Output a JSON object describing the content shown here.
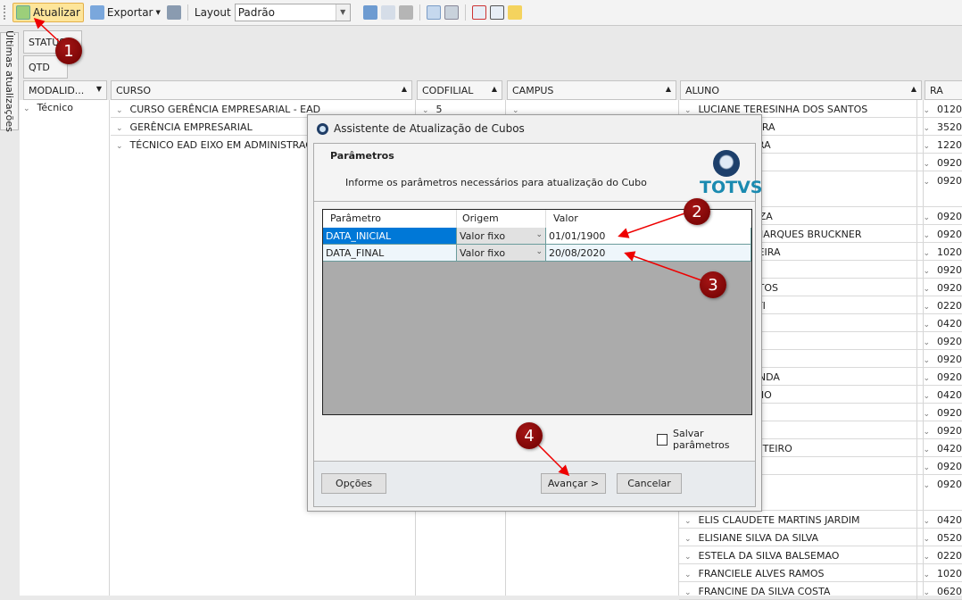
{
  "toolbar": {
    "refresh_label": "Atualizar",
    "export_label": "Exportar",
    "layout_label": "Layout",
    "layout_value": "Padrão"
  },
  "side_tab": {
    "label": "Últimas atualizações"
  },
  "fields": {
    "status": "STATUS",
    "qtd": "QTD"
  },
  "columns": {
    "modalidade": "MODALID...",
    "curso": "CURSO",
    "codfilial": "CODFILIAL",
    "campus": "CAMPUS",
    "aluno": "ALUNO",
    "ra": "RA"
  },
  "groups": {
    "modalidade": "Técnico",
    "cursos": [
      "CURSO GERÊNCIA EMPRESARIAL - EAD",
      "GERÊNCIA EMPRESARIAL",
      "TÉCNICO  EAD EIXO EM ADMINISTRAÇÃO"
    ],
    "codfilial": "5",
    "campus": ""
  },
  "alunos": [
    {
      "name": "LUCIANE TERESINHA DOS SANTOS",
      "ra": "0120"
    },
    {
      "name": "OS DA SILVEIRA",
      "ra": "3520"
    },
    {
      "name": "IA DA SILVEIRA",
      "ra": "1220"
    },
    {
      "name": "UZA",
      "ra": "0920"
    },
    {
      "name": "DA SILVA",
      "ra": "0920",
      "tall": true
    },
    {
      "name": "ARA DE SOUZA",
      "ra": "0920"
    },
    {
      "name": "A MENZEM MARQUES BRUCKNER",
      "ra": "0920"
    },
    {
      "name": "ZAUZA OLIVEIRA",
      "ra": "1020"
    },
    {
      "name": "O VIEIRA",
      "ra": "0920"
    },
    {
      "name": "EL DOS SANTOS",
      "ra": "0920"
    },
    {
      "name": "UDO PEDRETI",
      "ra": "0220"
    },
    {
      "name": "DA SILVA",
      "ra": "0420"
    },
    {
      "name": "Z VIEIRA",
      "ra": "0920"
    },
    {
      "name": "VIERO",
      "ra": "0920"
    },
    {
      "name": "SKI DE MIRANDA",
      "ra": "0920"
    },
    {
      "name": "VEIRA COELHO",
      "ra": "0420"
    },
    {
      "name": "A CHAGAS",
      "ra": "0920"
    },
    {
      "name": "ALVES",
      "ra": "0920"
    },
    {
      "name": "ARAUJO MONTEIRO",
      "ra": "0420"
    },
    {
      "name": "RUGA LOPES",
      "ra": "0920"
    },
    {
      "name": "A SILVA",
      "ra": "0920",
      "tall": true
    },
    {
      "name": "ELIS CLAUDETE MARTINS JARDIM",
      "ra": "0420"
    },
    {
      "name": "ELISIANE SILVA DA SILVA",
      "ra": "0520"
    },
    {
      "name": "ESTELA DA SILVA BALSEMAO",
      "ra": "0220"
    },
    {
      "name": "FRANCIELE ALVES RAMOS",
      "ra": "1020"
    },
    {
      "name": "FRANCINE DA SILVA COSTA",
      "ra": "0620"
    }
  ],
  "dialog": {
    "title": "Assistente de Atualização de Cubos",
    "heading": "Parâmetros",
    "description": "Informe os parâmetros necessários para atualização do Cubo",
    "logo_text": "TOTVS",
    "grid_headers": [
      "Parâmetro",
      "Origem",
      "Valor"
    ],
    "params": [
      {
        "name": "DATA_INICIAL",
        "origem": "Valor fixo",
        "valor": "01/01/1900"
      },
      {
        "name": "DATA_FINAL",
        "origem": "Valor fixo",
        "valor": "20/08/2020"
      }
    ],
    "save_params_label": "Salvar parâmetros",
    "save_params_checked": false,
    "options_label": "Opções",
    "next_label": "Avançar >",
    "cancel_label": "Cancelar"
  },
  "annotations": [
    "1",
    "2",
    "3",
    "4"
  ],
  "colors": {
    "accent_red": "#8b0000",
    "selection": "#0078d7",
    "logo": "#1a8ab0"
  }
}
